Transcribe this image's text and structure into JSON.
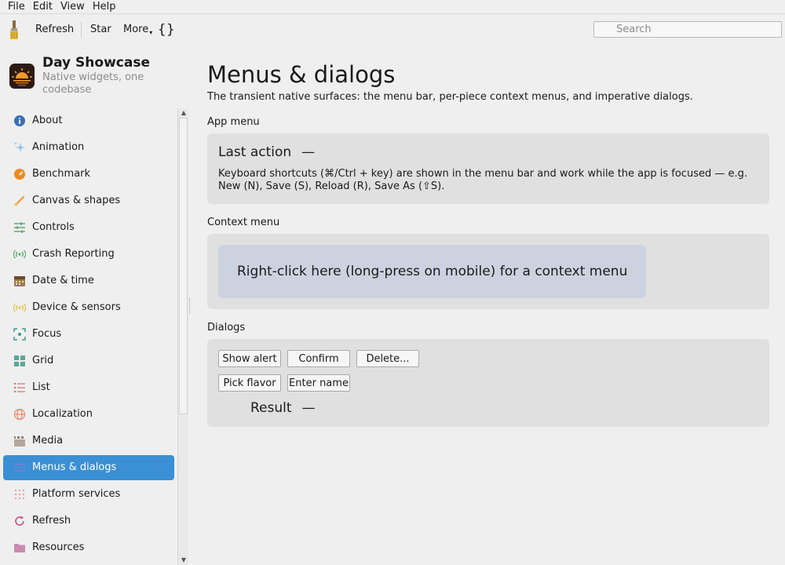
{
  "menubar": {
    "items": [
      "File",
      "Edit",
      "View",
      "Help"
    ]
  },
  "toolbar": {
    "refresh_label": "Refresh",
    "star_label": "Star",
    "more_label": "More",
    "braces_label": "{}",
    "search_placeholder": "Search"
  },
  "app": {
    "title": "Day Showcase",
    "subtitle": "Native widgets, one codebase"
  },
  "sidebar": {
    "items": [
      {
        "label": "About",
        "icon": "info-icon"
      },
      {
        "label": "Animation",
        "icon": "sparkle-icon"
      },
      {
        "label": "Benchmark",
        "icon": "gauge-icon"
      },
      {
        "label": "Canvas & shapes",
        "icon": "brush-icon"
      },
      {
        "label": "Controls",
        "icon": "sliders-icon"
      },
      {
        "label": "Crash Reporting",
        "icon": "broadcast-icon"
      },
      {
        "label": "Date & time",
        "icon": "calendar-icon"
      },
      {
        "label": "Device & sensors",
        "icon": "sensor-icon"
      },
      {
        "label": "Focus",
        "icon": "focus-icon"
      },
      {
        "label": "Grid",
        "icon": "grid-icon"
      },
      {
        "label": "List",
        "icon": "list-icon"
      },
      {
        "label": "Localization",
        "icon": "globe-icon"
      },
      {
        "label": "Media",
        "icon": "clapper-icon"
      },
      {
        "label": "Menus & dialogs",
        "icon": "menu-icon",
        "active": true
      },
      {
        "label": "Platform services",
        "icon": "dots-grid-icon"
      },
      {
        "label": "Refresh",
        "icon": "refresh-icon"
      },
      {
        "label": "Resources",
        "icon": "folder-icon"
      }
    ]
  },
  "main": {
    "title": "Menus & dialogs",
    "description": "The transient native surfaces: the menu bar, per-piece context menus, and imperative dialogs.",
    "app_menu": {
      "label": "App menu",
      "last_action_label": "Last action",
      "last_action_value": "—",
      "shortcut_note": "Keyboard shortcuts (⌘/Ctrl + key) are shown in the menu bar and work while the app is focused — e.g. New (N), Save (S), Reload (R), Save As (⇧S)."
    },
    "context_menu": {
      "label": "Context menu",
      "area_text": "Right-click here (long-press on mobile) for a context menu"
    },
    "dialogs": {
      "label": "Dialogs",
      "buttons": [
        "Show alert",
        "Confirm",
        "Delete...",
        "Pick flavor",
        "Enter name"
      ],
      "result_label": "Result",
      "result_value": "—"
    }
  },
  "colors": {
    "accent": "#3b8fd4",
    "panel": "#e0e0e0",
    "context_area": "#cdd2e0",
    "background": "#efefef"
  }
}
